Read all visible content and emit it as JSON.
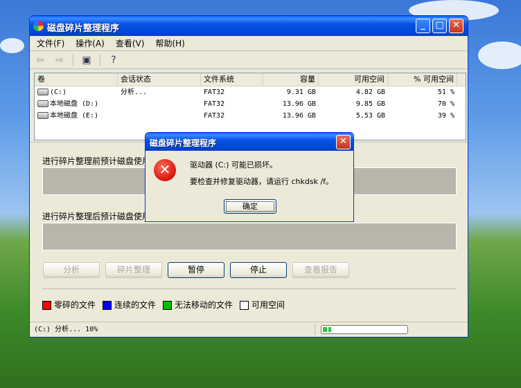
{
  "window": {
    "title": "磁盘碎片整理程序"
  },
  "menu": [
    "文件(F)",
    "操作(A)",
    "查看(V)",
    "帮助(H)"
  ],
  "columns": [
    "卷",
    "会话状态",
    "文件系统",
    "容量",
    "可用空间",
    "% 可用空间"
  ],
  "volumes": [
    {
      "name": "(C:)",
      "status": "分析...",
      "fs": "FAT32",
      "capacity": "9.31 GB",
      "free": "4.82 GB",
      "pct": "51 %"
    },
    {
      "name": "本地磁盘 (D:)",
      "status": "",
      "fs": "FAT32",
      "capacity": "13.96 GB",
      "free": "9.85 GB",
      "pct": "70 %"
    },
    {
      "name": "本地磁盘 (E:)",
      "status": "",
      "fs": "FAT32",
      "capacity": "13.96 GB",
      "free": "5.53 GB",
      "pct": "39 %"
    }
  ],
  "labels": {
    "before": "进行碎片整理前预计磁盘使用量:",
    "after": "进行碎片整理后预计磁盘使用量:"
  },
  "buttons": {
    "analyze": "分析",
    "defrag": "碎片整理",
    "pause": "暂停",
    "stop": "停止",
    "report": "查看报告"
  },
  "legend": [
    "零碎的文件",
    "连续的文件",
    "无法移动的文件",
    "可用空间"
  ],
  "legend_colors": [
    "#ff0000",
    "#0000ff",
    "#00c000",
    "#ffffff"
  ],
  "status": {
    "text": "(C:) 分析... 10%",
    "progress": 0.1
  },
  "dialog": {
    "title": "磁盘碎片整理程序",
    "line1": "驱动器 (C:) 可能已损坏。",
    "line2": "要检查并修复驱动器，请运行 chkdsk /f。",
    "ok": "确定"
  }
}
